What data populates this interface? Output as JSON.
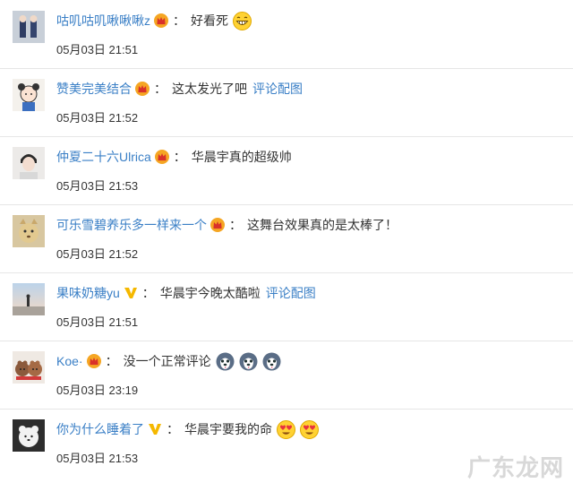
{
  "comments": [
    {
      "user": "咕叽咕叽啾啾啾z",
      "badge": "crown",
      "text": "好看死",
      "link": "",
      "emojis": [
        "grin"
      ],
      "time": "05月03日 21:51"
    },
    {
      "user": "赞美完美结合",
      "badge": "crown",
      "text": "这太发光了吧",
      "link": "评论配图",
      "emojis": [],
      "time": "05月03日 21:52"
    },
    {
      "user": "仲夏二十六Ulrica",
      "badge": "crown",
      "text": "华晨宇真的超级帅",
      "link": "",
      "emojis": [],
      "time": "05月03日 21:53"
    },
    {
      "user": "可乐雪碧养乐多一样来一个",
      "badge": "crown",
      "text": "这舞台效果真的是太棒了！",
      "link": "",
      "emojis": [],
      "time": "05月03日 21:52"
    },
    {
      "user": "果味奶糖yu",
      "badge": "v",
      "text": "华晨宇今晚太酷啦",
      "link": "评论配图",
      "emojis": [],
      "time": "05月03日 21:51"
    },
    {
      "user": "Koe·",
      "badge": "crown",
      "text": "没一个正常评论",
      "link": "",
      "emojis": [
        "husky",
        "husky",
        "husky"
      ],
      "time": "05月03日 23:19"
    },
    {
      "user": "你为什么睡着了",
      "badge": "v",
      "text": "华晨宇要我的命",
      "link": "",
      "emojis": [
        "heart-eyes",
        "heart-eyes"
      ],
      "time": "05月03日 21:53"
    }
  ],
  "colon": "：",
  "watermark": "广东龙网",
  "colors": {
    "username": "#3a7fc6",
    "text": "#333333",
    "divider": "#e6e6e6",
    "crown": "#f5a623",
    "v_badge": "#f5b800"
  }
}
